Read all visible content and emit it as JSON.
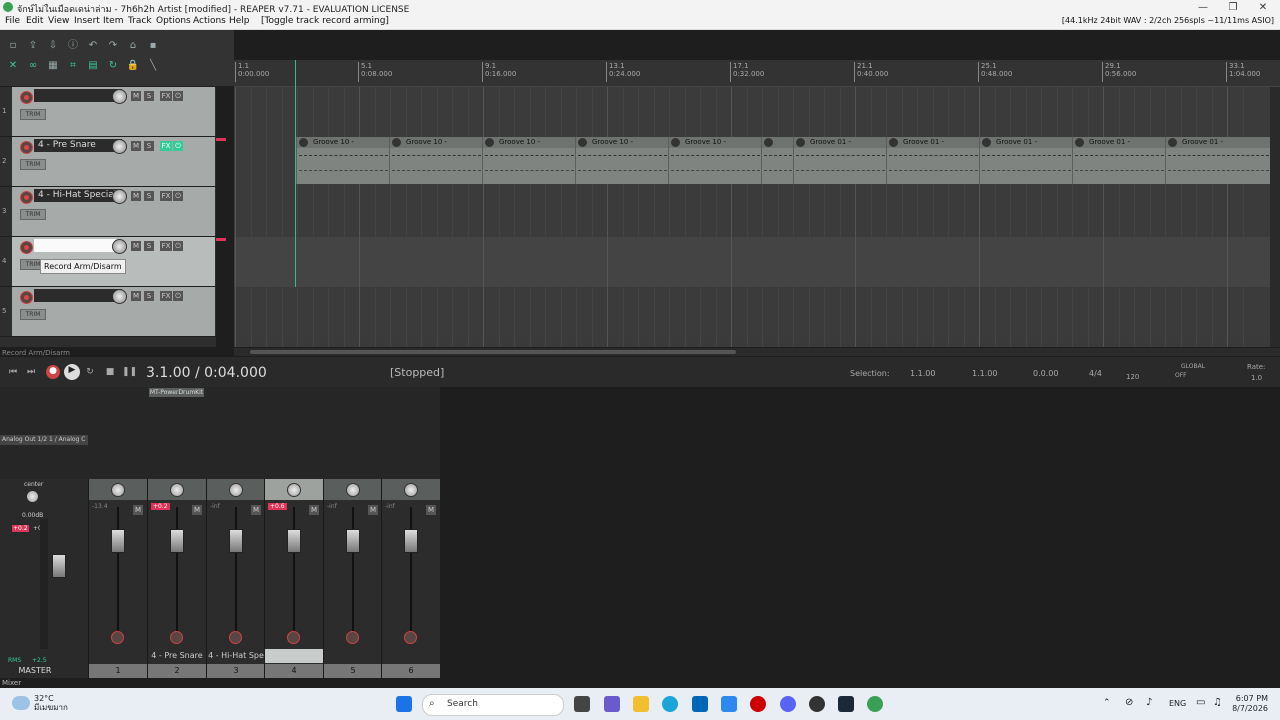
{
  "window": {
    "title": "จักษ์ไม่ในเมือดเดน่าล่าม - 7h6h2h Artist [modified] - REAPER v7.71 - EVALUATION LICENSE",
    "minimize": "—",
    "maximize": "❐",
    "close": "✕"
  },
  "menu": {
    "items": [
      "File",
      "Edit",
      "View",
      "Insert",
      "Item",
      "Track",
      "Options",
      "Actions",
      "Help",
      "[Toggle track record arming]"
    ],
    "audio_status": "[44.1kHz 24bit WAV : 2/2ch 256spls ~11/11ms ASIO]"
  },
  "ruler": {
    "marks": [
      {
        "bar": "1.1",
        "time": "0:00.000"
      },
      {
        "bar": "5.1",
        "time": "0:08.000"
      },
      {
        "bar": "9.1",
        "time": "0:16.000"
      },
      {
        "bar": "13.1",
        "time": "0:24.000"
      },
      {
        "bar": "17.1",
        "time": "0:32.000"
      },
      {
        "bar": "21.1",
        "time": "0:40.000"
      },
      {
        "bar": "25.1",
        "time": "0:48.000"
      },
      {
        "bar": "29.1",
        "time": "0:56.000"
      },
      {
        "bar": "33.1",
        "time": "1:04.000"
      }
    ]
  },
  "tracks": [
    {
      "num": "1",
      "name": "",
      "m": "M",
      "s": "S",
      "fx": "FX",
      "trim": "TRIM"
    },
    {
      "num": "2",
      "name": "4 - Pre Snare",
      "m": "M",
      "s": "S",
      "fx": "FX",
      "trim": "TRIM"
    },
    {
      "num": "3",
      "name": "4 - Hi-Hat Special",
      "m": "M",
      "s": "S",
      "fx": "FX",
      "trim": "TRIM"
    },
    {
      "num": "4",
      "name": "",
      "m": "M",
      "s": "S",
      "fx": "FX",
      "trim": "TRIM"
    },
    {
      "num": "5",
      "name": "",
      "m": "M",
      "s": "S",
      "fx": "FX",
      "trim": "TRIM"
    }
  ],
  "midi_items": [
    "Groove 10 -",
    "Groove 10 -",
    "Groove 10 -",
    "Groove 10 -",
    "Groove 10 -",
    "",
    "Groove 01 -",
    "Groove 01 -",
    "Groove 01 -",
    "Groove 01 -",
    "Groove 01 -"
  ],
  "tooltip": "Record Arm/Disarm",
  "status_line": "Record Arm/Disarm",
  "transport": {
    "position": "3.1.00 / 0:04.000",
    "state": "[Stopped]",
    "selection_label": "Selection:",
    "sel_start": "1.1.00",
    "sel_end": "1.1.00",
    "sel_len": "0.0.00",
    "time_sig": "4/4",
    "tempo": "120",
    "global": "GLOBAL",
    "global_state": "OFF",
    "rate_label": "Rate:",
    "rate": "1.0"
  },
  "mixer": {
    "fx_name": "MT-PowerDrumKit",
    "routing": "Analog Out 1/2 1 / Analog C",
    "master_label": "MASTER",
    "master_pan": "center",
    "master_db": "0.00dB",
    "master_peak_l": "+0.2",
    "master_peak_r": "+0.0",
    "rms": "RMS",
    "rms_val": "+2.5",
    "mixer_tab": "Mixer",
    "strips": [
      {
        "num": "1",
        "label": "",
        "peak": "-13.4",
        "peak_hot": false,
        "hl": false
      },
      {
        "num": "2",
        "label": "4 - Pre Snare",
        "peak": "+0.2",
        "peak_hot": true,
        "hl": false
      },
      {
        "num": "3",
        "label": "4 - Hi-Hat Spe",
        "peak": "-inf",
        "peak_hot": false,
        "hl": false
      },
      {
        "num": "4",
        "label": "",
        "peak": "+0.6",
        "peak_hot": true,
        "hl": true
      },
      {
        "num": "5",
        "label": "",
        "peak": "-inf",
        "peak_hot": false,
        "hl": false
      },
      {
        "num": "6",
        "label": "",
        "peak": "-inf",
        "peak_hot": false,
        "hl": false
      }
    ]
  },
  "taskbar": {
    "temp": "32°C",
    "weather": "มีเมฆมาก",
    "search": "Search",
    "lang": "ENG",
    "time": "6:07 PM",
    "date": "8/7/2026"
  }
}
